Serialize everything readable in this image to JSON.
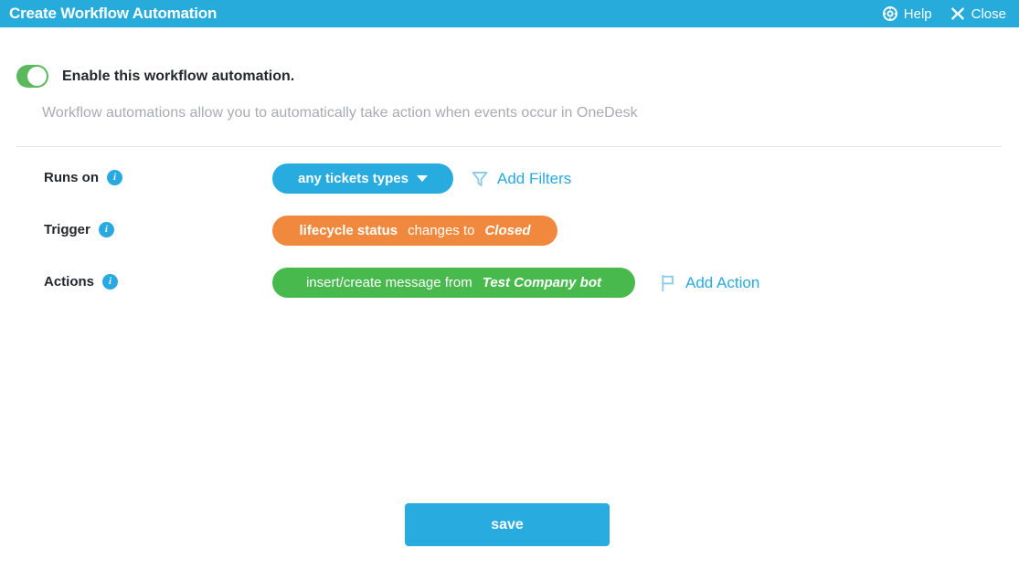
{
  "titlebar": {
    "title": "Create Workflow Automation",
    "help_label": "Help",
    "help_icon": "lifebuoy-icon",
    "close_label": "Close",
    "close_icon": "close-icon",
    "background_color": "#27abda"
  },
  "enable": {
    "label": "Enable this workflow automation.",
    "enabled": true,
    "toggle_on_color": "#5cb85c"
  },
  "description": "Workflow automations allow you to automatically take action when events occur in OneDesk",
  "rows": {
    "runs_on": {
      "label": "Runs on",
      "info_icon": "info-icon",
      "pill": {
        "text": "any tickets types",
        "color": "#28ace0",
        "caret_icon": "chevron-down-icon"
      },
      "add_link": {
        "label": "Add Filters",
        "icon": "filter-funnel-icon",
        "color": "#28a9df"
      }
    },
    "trigger": {
      "label": "Trigger",
      "info_icon": "info-icon",
      "pill": {
        "field": "lifecycle status",
        "operator": "changes to",
        "value": "Closed",
        "color": "#f0893e"
      }
    },
    "actions": {
      "label": "Actions",
      "info_icon": "info-icon",
      "pill": {
        "action": "insert/create message from",
        "value": "Test Company bot",
        "color": "#48b94c"
      },
      "add_link": {
        "label": "Add Action",
        "icon": "flag-icon",
        "color": "#28a9df"
      }
    }
  },
  "footer": {
    "save_label": "save",
    "save_color": "#28ace0"
  }
}
